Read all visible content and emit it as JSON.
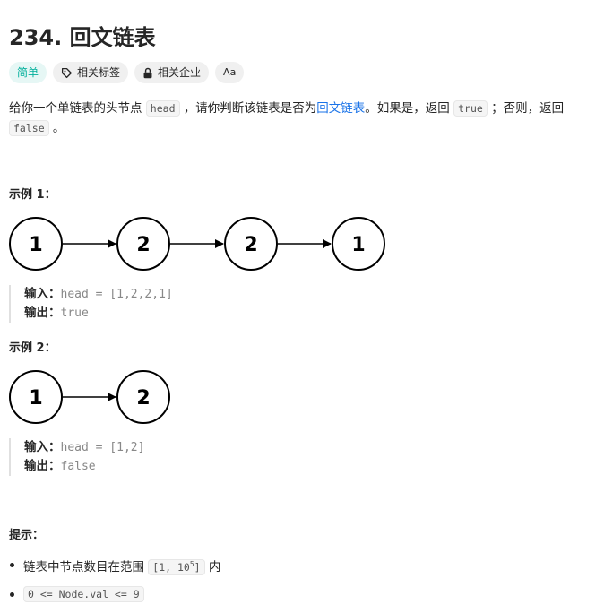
{
  "problem": {
    "number_title": "234. 回文链表"
  },
  "tags": {
    "difficulty": "简单",
    "related_tags": "相关标签",
    "related_companies": "相关企业",
    "font_icon_label": "Aa"
  },
  "description": {
    "part1": "给你一个单链表的头节点 ",
    "code_head": "head",
    "part2": " ，请你判断该链表是否为",
    "link": "回文链表",
    "part3": "。如果是，返回 ",
    "code_true": "true",
    "part4": " ；否则，返回 ",
    "code_false": "false",
    "part5": " 。"
  },
  "example1": {
    "title": "示例 1：",
    "nodes": [
      "1",
      "2",
      "2",
      "1"
    ],
    "input_label": "输入：",
    "input_value": "head = [1,2,2,1]",
    "output_label": "输出：",
    "output_value": "true"
  },
  "example2": {
    "title": "示例 2：",
    "nodes": [
      "1",
      "2"
    ],
    "input_label": "输入：",
    "input_value": "head = [1,2]",
    "output_label": "输出：",
    "output_value": "false"
  },
  "hints": {
    "title": "提示：",
    "item1_text": "链表中节点数目在范围 ",
    "item1_code_start": "[1, 10",
    "item1_code_sup": "5",
    "item1_code_end": "]",
    "item1_suffix": " 内",
    "item2_code": "0 <= Node.val <= 9"
  },
  "colors": {
    "easy": "#00af9b",
    "link": "#1a73e8",
    "text": "#262626"
  }
}
